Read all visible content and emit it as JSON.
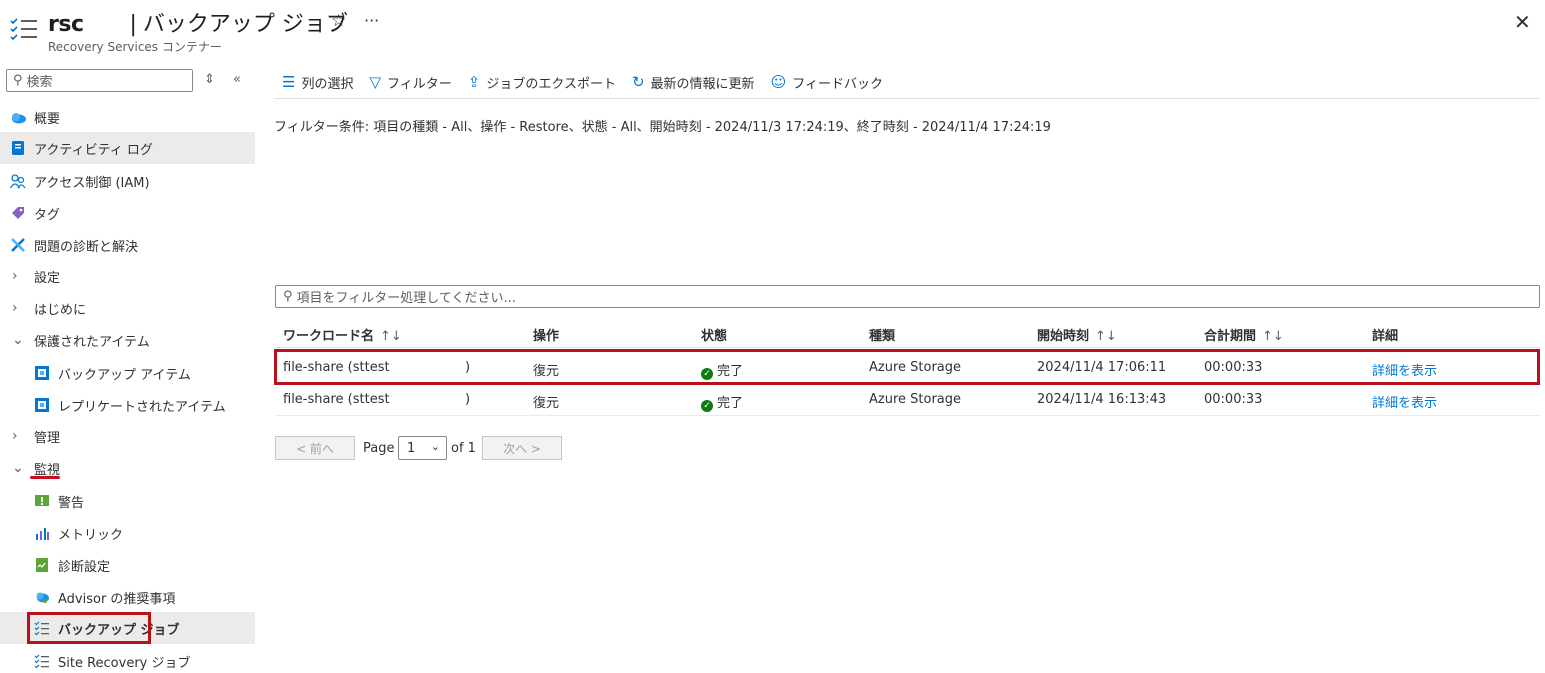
{
  "header": {
    "resource_name": "rsc",
    "separator": "|",
    "page_title": "バックアップ ジョブ",
    "subtitle": "Recovery Services コンテナー",
    "star_glyph": "☆",
    "more_glyph": "···",
    "close_glyph": "✕"
  },
  "sidebar": {
    "search_placeholder": "検索",
    "items": [
      {
        "label": "概要",
        "icon": "cloud-icon"
      },
      {
        "label": "アクティビティ ログ",
        "icon": "log-icon"
      },
      {
        "label": "アクセス制御 (IAM)",
        "icon": "people-icon"
      },
      {
        "label": "タグ",
        "icon": "tag-icon"
      },
      {
        "label": "問題の診断と解決",
        "icon": "wrench-icon"
      },
      {
        "label": "設定",
        "icon": "chevron-right-icon"
      },
      {
        "label": "はじめに",
        "icon": "chevron-right-icon"
      },
      {
        "label": "保護されたアイテム",
        "icon": "chevron-down-icon"
      },
      {
        "label": "バックアップ アイテム",
        "icon": "backup-item-icon"
      },
      {
        "label": "レプリケートされたアイテム",
        "icon": "replicated-item-icon"
      },
      {
        "label": "管理",
        "icon": "chevron-right-icon"
      },
      {
        "label": "監視",
        "icon": "chevron-down-icon"
      },
      {
        "label": "警告",
        "icon": "alert-icon"
      },
      {
        "label": "メトリック",
        "icon": "metrics-icon"
      },
      {
        "label": "診断設定",
        "icon": "diagnostic-icon"
      },
      {
        "label": "Advisor の推奨事項",
        "icon": "advisor-icon"
      },
      {
        "label": "バックアップ ジョブ",
        "icon": "jobs-icon"
      },
      {
        "label": "Site Recovery ジョブ",
        "icon": "jobs-icon"
      }
    ]
  },
  "toolbar": {
    "columns_label": "列の選択",
    "filter_label": "フィルター",
    "export_label": "ジョブのエクスポート",
    "refresh_label": "最新の情報に更新",
    "feedback_label": "フィードバック"
  },
  "filter_summary": "フィルター条件: 項目の種類 - All、操作 - Restore、状態 - All、開始時刻 - 2024/11/3 17:24:19、終了時刻 - 2024/11/4 17:24:19",
  "filter_input_placeholder": "項目をフィルター処理してください...",
  "table": {
    "columns": [
      "ワークロード名",
      "操作",
      "状態",
      "種類",
      "開始時刻",
      "合計期間",
      "詳細"
    ],
    "sort_glyph": "↑↓",
    "rows": [
      {
        "workload": "file-share (sttest",
        "workload_suffix": ")",
        "operation": "復元",
        "status": "完了",
        "type": "Azure Storage",
        "start": "2024/11/4 17:06:11",
        "duration": "00:00:33",
        "details": "詳細を表示"
      },
      {
        "workload": "file-share (sttest",
        "workload_suffix": ")",
        "operation": "復元",
        "status": "完了",
        "type": "Azure Storage",
        "start": "2024/11/4 16:13:43",
        "duration": "00:00:33",
        "details": "詳細を表示"
      }
    ]
  },
  "pager": {
    "prev_label": "< 前へ",
    "page_label": "Page",
    "current_page": "1",
    "of_label": "of 1",
    "next_label": "次へ >"
  },
  "colors": {
    "accent": "#0078d4",
    "highlight_border": "#b5121b",
    "success": "#107c10",
    "selected_bg": "#edebe9"
  }
}
